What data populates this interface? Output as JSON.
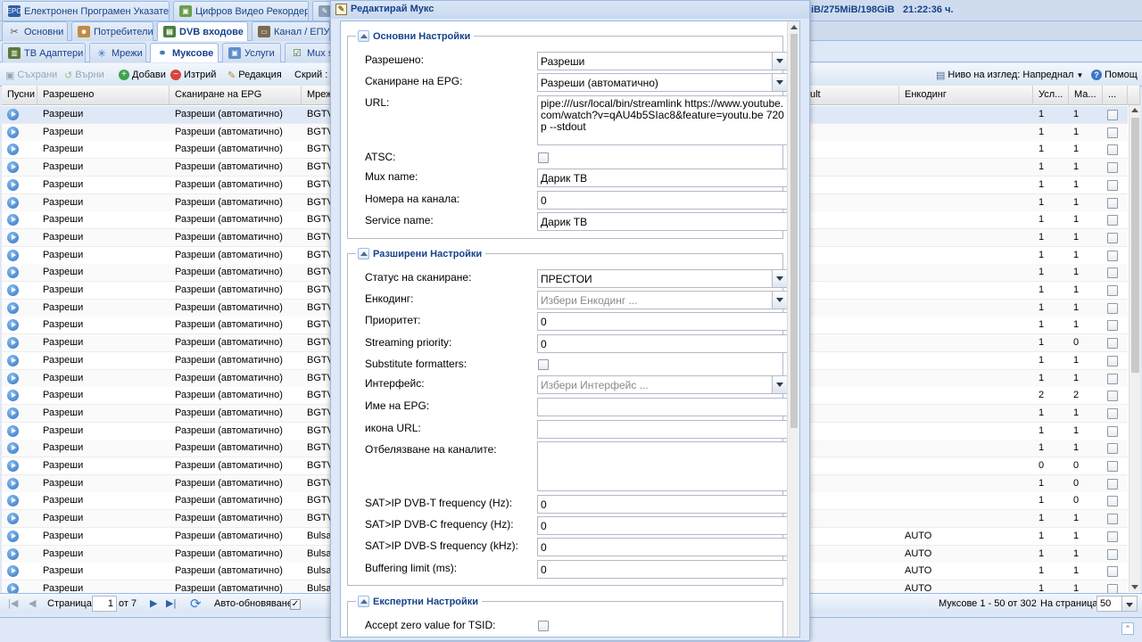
{
  "top_tabs": [
    {
      "label": "Електронен Програмен Указател",
      "icon": "epg-icon"
    },
    {
      "label": "Цифров Видео Рекордер",
      "icon": "dvr-icon"
    }
  ],
  "status_info": {
    "disk": "iB/275MiB/198GiB",
    "time": "21:22:36 ч."
  },
  "second_tabs": [
    {
      "label": "Основни",
      "icon": "wrench-icon"
    },
    {
      "label": "Потребители",
      "icon": "users-icon"
    },
    {
      "label": "DVB входове",
      "icon": "dvb-icon"
    },
    {
      "label": "Канал / ЕПУ",
      "icon": "channel-icon"
    }
  ],
  "third_tabs": [
    {
      "label": "ТВ Адаптери",
      "icon": "adapter-icon"
    },
    {
      "label": "Мрежи",
      "icon": "network-icon"
    },
    {
      "label": "Муксове",
      "icon": "mux-icon"
    },
    {
      "label": "Услуги",
      "icon": "services-icon"
    },
    {
      "label": "Mux sc",
      "icon": "mux-scheduler-icon"
    }
  ],
  "toolbar": {
    "save": "Съхрани",
    "revert": "Върни",
    "add": "Добави",
    "delete": "Изтрий",
    "edit": "Редакция",
    "hide": "Скрий :",
    "view_level": "Ниво на изглед: Напреднал",
    "help": "Помощ"
  },
  "grid": {
    "headers": {
      "play": "Пусни",
      "enabled": "Разрешено",
      "epg": "Сканиране на EPG",
      "network": "Мреж",
      "ult": "ult",
      "encoding": "Енкодинг",
      "services": "Усл...",
      "max": "Ма...",
      "more": "..."
    },
    "rows": [
      {
        "enabled": "Разреши",
        "epg": "Разреши (автоматично)",
        "network": "BGTV",
        "encoding": "",
        "services": "1",
        "max": "1"
      },
      {
        "enabled": "Разреши",
        "epg": "Разреши (автоматично)",
        "network": "BGTV",
        "encoding": "",
        "services": "1",
        "max": "1"
      },
      {
        "enabled": "Разреши",
        "epg": "Разреши (автоматично)",
        "network": "BGTV",
        "encoding": "",
        "services": "1",
        "max": "1"
      },
      {
        "enabled": "Разреши",
        "epg": "Разреши (автоматично)",
        "network": "BGTV",
        "encoding": "",
        "services": "1",
        "max": "1"
      },
      {
        "enabled": "Разреши",
        "epg": "Разреши (автоматично)",
        "network": "BGTV",
        "encoding": "",
        "services": "1",
        "max": "1"
      },
      {
        "enabled": "Разреши",
        "epg": "Разреши (автоматично)",
        "network": "BGTV",
        "encoding": "",
        "services": "1",
        "max": "1"
      },
      {
        "enabled": "Разреши",
        "epg": "Разреши (автоматично)",
        "network": "BGTV",
        "encoding": "",
        "services": "1",
        "max": "1"
      },
      {
        "enabled": "Разреши",
        "epg": "Разреши (автоматично)",
        "network": "BGTV",
        "encoding": "",
        "services": "1",
        "max": "1"
      },
      {
        "enabled": "Разреши",
        "epg": "Разреши (автоматично)",
        "network": "BGTV",
        "encoding": "",
        "services": "1",
        "max": "1"
      },
      {
        "enabled": "Разреши",
        "epg": "Разреши (автоматично)",
        "network": "BGTV",
        "encoding": "",
        "services": "1",
        "max": "1"
      },
      {
        "enabled": "Разреши",
        "epg": "Разреши (автоматично)",
        "network": "BGTV",
        "encoding": "",
        "services": "1",
        "max": "1"
      },
      {
        "enabled": "Разреши",
        "epg": "Разреши (автоматично)",
        "network": "BGTV",
        "encoding": "",
        "services": "1",
        "max": "1"
      },
      {
        "enabled": "Разреши",
        "epg": "Разреши (автоматично)",
        "network": "BGTV",
        "encoding": "",
        "services": "1",
        "max": "1"
      },
      {
        "enabled": "Разреши",
        "epg": "Разреши (автоматично)",
        "network": "BGTV",
        "encoding": "",
        "services": "1",
        "max": "0"
      },
      {
        "enabled": "Разреши",
        "epg": "Разреши (автоматично)",
        "network": "BGTV",
        "encoding": "",
        "services": "1",
        "max": "1"
      },
      {
        "enabled": "Разреши",
        "epg": "Разреши (автоматично)",
        "network": "BGTV",
        "encoding": "",
        "services": "1",
        "max": "1"
      },
      {
        "enabled": "Разреши",
        "epg": "Разреши (автоматично)",
        "network": "BGTV",
        "encoding": "",
        "services": "2",
        "max": "2"
      },
      {
        "enabled": "Разреши",
        "epg": "Разреши (автоматично)",
        "network": "BGTV",
        "encoding": "",
        "services": "1",
        "max": "1"
      },
      {
        "enabled": "Разреши",
        "epg": "Разреши (автоматично)",
        "network": "BGTV",
        "encoding": "",
        "services": "1",
        "max": "1"
      },
      {
        "enabled": "Разреши",
        "epg": "Разреши (автоматично)",
        "network": "BGTV",
        "encoding": "",
        "services": "1",
        "max": "1"
      },
      {
        "enabled": "Разреши",
        "epg": "Разреши (автоматично)",
        "network": "BGTV",
        "encoding": "",
        "services": "0",
        "max": "0"
      },
      {
        "enabled": "Разреши",
        "epg": "Разреши (автоматично)",
        "network": "BGTV",
        "encoding": "",
        "services": "1",
        "max": "0"
      },
      {
        "enabled": "Разреши",
        "epg": "Разреши (автоматично)",
        "network": "BGTV",
        "encoding": "",
        "services": "1",
        "max": "0"
      },
      {
        "enabled": "Разреши",
        "epg": "Разреши (автоматично)",
        "network": "BGTV",
        "encoding": "",
        "services": "1",
        "max": "1"
      },
      {
        "enabled": "Разреши",
        "epg": "Разреши (автоматично)",
        "network": "Bulsa",
        "encoding": "AUTO",
        "services": "1",
        "max": "1"
      },
      {
        "enabled": "Разреши",
        "epg": "Разреши (автоматично)",
        "network": "Bulsa",
        "encoding": "AUTO",
        "services": "1",
        "max": "1"
      },
      {
        "enabled": "Разреши",
        "epg": "Разреши (автоматично)",
        "network": "Bulsa",
        "encoding": "AUTO",
        "services": "1",
        "max": "1"
      },
      {
        "enabled": "Разреши",
        "epg": "Разреши (автоматично)",
        "network": "Bulsa",
        "encoding": "AUTO",
        "services": "1",
        "max": "1"
      }
    ]
  },
  "pager": {
    "page_label": "Страница",
    "page": "1",
    "of": "от 7",
    "auto_refresh": "Авто-обновяване",
    "summary": "Муксове 1 - 50 от 302",
    "per_page_label": "На страница",
    "per_page": "50"
  },
  "modal": {
    "title": "Редактирай Мукс",
    "basic": {
      "legend": "Основни Настройки",
      "enabled_label": "Разрешено:",
      "enabled_value": "Разреши",
      "epg_label": "Сканиране на EPG:",
      "epg_value": "Разреши (автоматично)",
      "url_label": "URL:",
      "url_value": "pipe:///usr/local/bin/streamlink https://www.youtube.com/watch?v=qAU4b5SIac8&feature=youtu.be 720p --stdout",
      "atsc_label": "ATSC:",
      "mux_name_label": "Mux name:",
      "mux_name_value": "Дарик ТВ",
      "channel_num_label": "Номера на канала:",
      "channel_num_value": "0",
      "service_name_label": "Service name:",
      "service_name_value": "Дарик ТВ"
    },
    "advanced": {
      "legend": "Разширени Настройки",
      "scan_status_label": "Статус на сканиране:",
      "scan_status_value": "ПРЕСТОИ",
      "encoding_label": "Енкодинг:",
      "encoding_placeholder": "Избери Енкодинг ...",
      "priority_label": "Приоритет:",
      "priority_value": "0",
      "streaming_priority_label": "Streaming priority:",
      "streaming_priority_value": "0",
      "substitute_label": "Substitute formatters:",
      "interface_label": "Интерфейс:",
      "interface_placeholder": "Избери Интерфейс ...",
      "epg_name_label": "Име на EPG:",
      "epg_name_value": "",
      "icon_url_label": "икона URL:",
      "icon_url_value": "",
      "channel_tag_label": "Отбелязване на каналите:",
      "channel_tag_value": "",
      "satip_t_label": "SAT>IP DVB-T frequency (Hz):",
      "satip_t_value": "0",
      "satip_c_label": "SAT>IP DVB-C frequency (Hz):",
      "satip_c_value": "0",
      "satip_s_label": "SAT>IP DVB-S frequency (kHz):",
      "satip_s_value": "0",
      "buffering_label": "Buffering limit (ms):",
      "buffering_value": "0"
    },
    "expert": {
      "legend": "Експертни Настройки",
      "zero_tsid_label": "Accept zero value for TSID:"
    }
  },
  "colors": {
    "accent": "#15428b",
    "panel": "#dfe8f6",
    "border": "#99bbe8"
  }
}
